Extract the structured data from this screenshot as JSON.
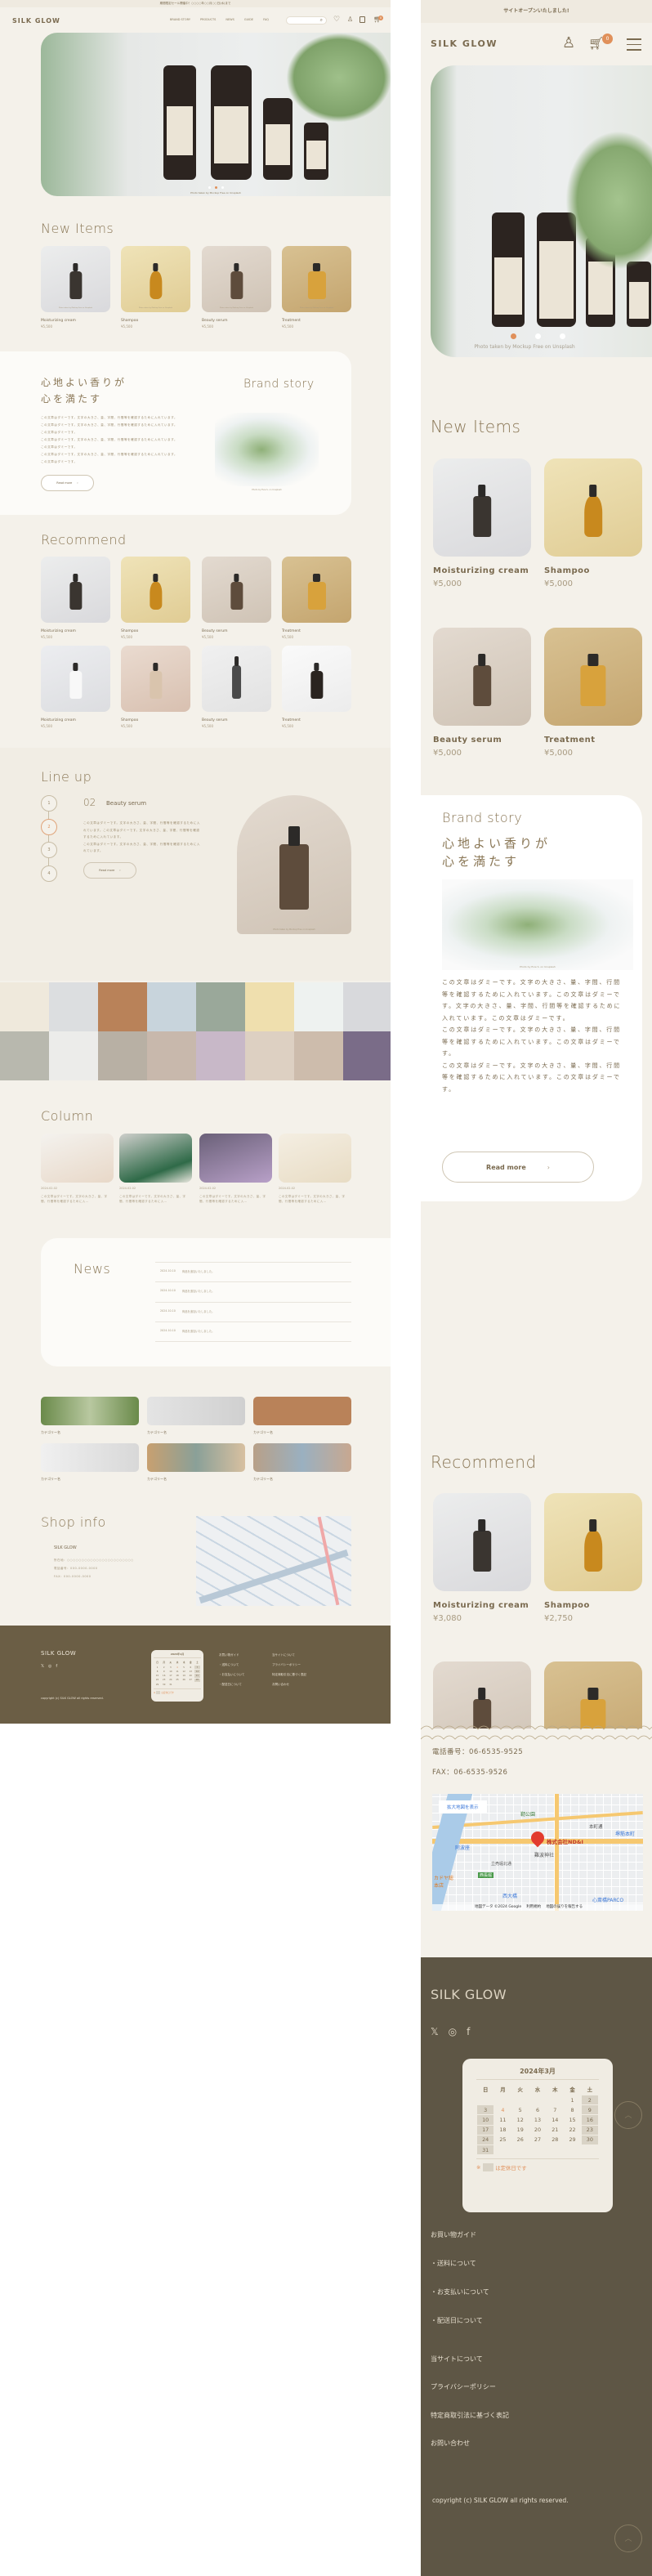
{
  "desktop": {
    "topbar": "期間限定セール開催中！○○○○年○○月○○日(水)まで",
    "logo": "SILK GLOW",
    "nav": [
      "BRAND STORY",
      "PRODUCTS",
      "NEWS",
      "GUIDE",
      "FAQ"
    ],
    "search_placeholder": "",
    "cart_count": "0",
    "hero_caption": "Photo taken by Mockup Free on Unsplash",
    "hero_slide_active": 2,
    "hero_slide_count": 3,
    "new_items": {
      "title": "New Items",
      "items": [
        {
          "name": "Moisturizing cream",
          "price": "¥5,500",
          "caption": "Photo taken by Mockup Free on Unsplash"
        },
        {
          "name": "Shampoo",
          "price": "¥5,500",
          "caption": "Photo taken by Mockup Free on Unsplash"
        },
        {
          "name": "Beauty serum",
          "price": "¥5,500",
          "caption": "Photo taken by Mockup Free on Unsplash"
        },
        {
          "name": "Treatment",
          "price": "¥5,500",
          "caption": "Photo taken by Mockup Free on Unsplash"
        }
      ]
    },
    "brand_story": {
      "title": "Brand story",
      "heading_1": "心地よい香りが",
      "heading_2": "心を満たす",
      "body": [
        "この文章はダミーです。文字の大きさ、量、字間、行間等を確認するために入れています。この文章はダミーです。文字の大きさ、量、字間、行間等を確認するために入れています。この文章はダミーです。",
        "この文章はダミーです。文字の大きさ、量、字間、行間等を確認するために入れています。この文章はダミーです。",
        "この文章はダミーです。文字の大きさ、量、字間、行間等を確認するために入れています。この文章はダミーです。"
      ],
      "image_caption": "Photo by Evie S. on Unsplash",
      "read_more": "Read more"
    },
    "recommend": {
      "title": "Recommend",
      "items": [
        {
          "name": "Moisturizing cream",
          "price": "¥5,500"
        },
        {
          "name": "Shampoo",
          "price": "¥5,500"
        },
        {
          "name": "Beauty serum",
          "price": "¥5,500"
        },
        {
          "name": "Treatment",
          "price": "¥5,500"
        },
        {
          "name": "Moisturizing cream",
          "price": "¥5,500"
        },
        {
          "name": "Shampoo",
          "price": "¥5,500"
        },
        {
          "name": "Beauty serum",
          "price": "¥5,500"
        },
        {
          "name": "Treatment",
          "price": "¥5,500"
        }
      ]
    },
    "lineup": {
      "title": "Line up",
      "steps": [
        "1",
        "2",
        "3",
        "4"
      ],
      "active_step": 2,
      "number": "02",
      "name": "Beauty serum",
      "body": [
        "この文章はダミーです。文字の大きさ、量、字間、行間等を確認するために入れています。この文章はダミーです。文字の大きさ、量、字間、行間等を確認するために入れています。",
        "この文章はダミーです。文字の大きさ、量、字間、行間等を確認するために入れています。"
      ],
      "read_more": "Read more",
      "image_caption": "Photo taken by Mockup Free on Unsplash"
    },
    "column": {
      "title": "Column",
      "items": [
        {
          "date": "2024.02.02",
          "text": "この文章はダミーです。文字の大きさ、量、字間、行間等を確認するために入…"
        },
        {
          "date": "2024.02.02",
          "text": "この文章はダミーです。文字の大きさ、量、字間、行間等を確認するために入…"
        },
        {
          "date": "2024.02.02",
          "text": "この文章はダミーです。文字の大きさ、量、字間、行間等を確認するために入…"
        },
        {
          "date": "2024.02.02",
          "text": "この文章はダミーです。文字の大きさ、量、字間、行間等を確認するために入…"
        }
      ]
    },
    "news": {
      "title": "News",
      "items": [
        {
          "date": "2024.10.10",
          "text": "商品を追加いたしました。"
        },
        {
          "date": "2024.10.10",
          "text": "商品を追加いたしました。"
        },
        {
          "date": "2024.10.10",
          "text": "商品を追加いたしました。"
        },
        {
          "date": "2024.10.10",
          "text": "商品を追加いたしました。"
        }
      ]
    },
    "categories": [
      "カテゴリー名",
      "カテゴリー名",
      "カテゴリー名",
      "カテゴリー名",
      "カテゴリー名",
      "カテゴリー名"
    ],
    "shop_info": {
      "title": "Shop info",
      "name": "SILK GLOW",
      "address": "所在地：○○○○○○○○○○○○○○○○○○○○○○○",
      "tel": "電話番号：000-0000-0000",
      "fax": "FAX：000-0000-0000"
    },
    "footer": {
      "logo": "SILK GLOW",
      "copyright": "copyright (c) SILK GLOW all rights reserved.",
      "calendar": {
        "month": "2024年1月",
        "weekdays": [
          "日",
          "月",
          "火",
          "水",
          "木",
          "金",
          "土"
        ],
        "legend_mark": "※",
        "legend": "は定休日です",
        "today": 4,
        "holidays": [
          7,
          14,
          21,
          28
        ]
      },
      "guide_title": "お買い物ガイド",
      "guide_links": [
        "・送料について",
        "・お支払いについて",
        "・配送日について"
      ],
      "links": [
        "当サイトについて",
        "プライバシーポリシー",
        "特定商取引法に基づく表記",
        "お問い合わせ"
      ]
    }
  },
  "mobile": {
    "topbar": "サイトオープンいたしました!",
    "logo": "SILK GLOW",
    "cart_count": "0",
    "hero_caption": "Photo taken by Mockup Free on Unsplash",
    "hero_slide_active": 1,
    "new_items": {
      "title": "New Items",
      "items": [
        {
          "name": "Moisturizing cream",
          "price": "¥5,000"
        },
        {
          "name": "Shampoo",
          "price": "¥5,000"
        },
        {
          "name": "Beauty serum",
          "price": "¥5,000"
        },
        {
          "name": "Treatment",
          "price": "¥5,000"
        }
      ]
    },
    "brand_story": {
      "title": "Brand story",
      "heading_1": "心地よい香りが",
      "heading_2": "心を満たす",
      "image_caption": "Photo by Evie S. on Unsplash",
      "body": [
        "この文章はダミーです。文字の大きさ、量、字間、行間等を確認するために入れています。この文章はダミーです。文字の大きさ、量、字間、行間等を確認するために入れています。この文章はダミーです。",
        "この文章はダミーです。文字の大きさ、量、字間、行間等を確認するために入れています。この文章はダミーです。",
        "この文章はダミーです。文字の大きさ、量、字間、行間等を確認するために入れています。この文章はダミーです。"
      ],
      "read_more": "Read more"
    },
    "recommend": {
      "title": "Recommend",
      "items": [
        {
          "name": "Moisturizing cream",
          "price": "¥3,080"
        },
        {
          "name": "Shampoo",
          "price": "¥2,750"
        },
        {
          "name": "",
          "price": ""
        },
        {
          "name": "",
          "price": ""
        }
      ]
    },
    "shop_info": {
      "tel": "電話番号：06-6535-9525",
      "fax": "FAX：06-6535-9526",
      "map_link": "拡大地図を表示",
      "map_pin_label": "株式会社ND&I",
      "map_labels": [
        "靭公園",
        "阿波座",
        "難波神社",
        "本町通",
        "堺筋本町",
        "立売堀北通",
        "西長堀",
        "カドヤ総本店",
        "西大橋",
        "心斎橋PARCO"
      ],
      "map_attribution": "地図データ ©2024 Google",
      "map_terms": "利用規約",
      "map_report": "地図の誤りを報告する"
    },
    "footer": {
      "logo": "SILK GLOW",
      "calendar": {
        "month": "2024年3月",
        "weekdays": [
          "日",
          "月",
          "火",
          "水",
          "木",
          "金",
          "土"
        ],
        "legend_mark": "※",
        "legend": "は定休日です",
        "today": 4,
        "holidays": [
          2,
          3,
          9,
          10,
          16,
          17,
          23,
          24,
          30,
          31
        ]
      },
      "guide_title": "お買い物ガイド",
      "guide_links": [
        "・送料について",
        "・お支払いについて",
        "・配送日について"
      ],
      "links": [
        "当サイトについて",
        "プライバシーポリシー",
        "特定商取引法に基づく表記",
        "お問い合わせ"
      ],
      "copyright": "copyright (c) SILK GLOW all rights reserved."
    }
  },
  "colors": {
    "accent": "#e0905a",
    "text": "#7a6a4f",
    "background": "#f4f1ea",
    "footer_desktop": "#6b5e45",
    "footer_mobile": "#5e5645"
  }
}
